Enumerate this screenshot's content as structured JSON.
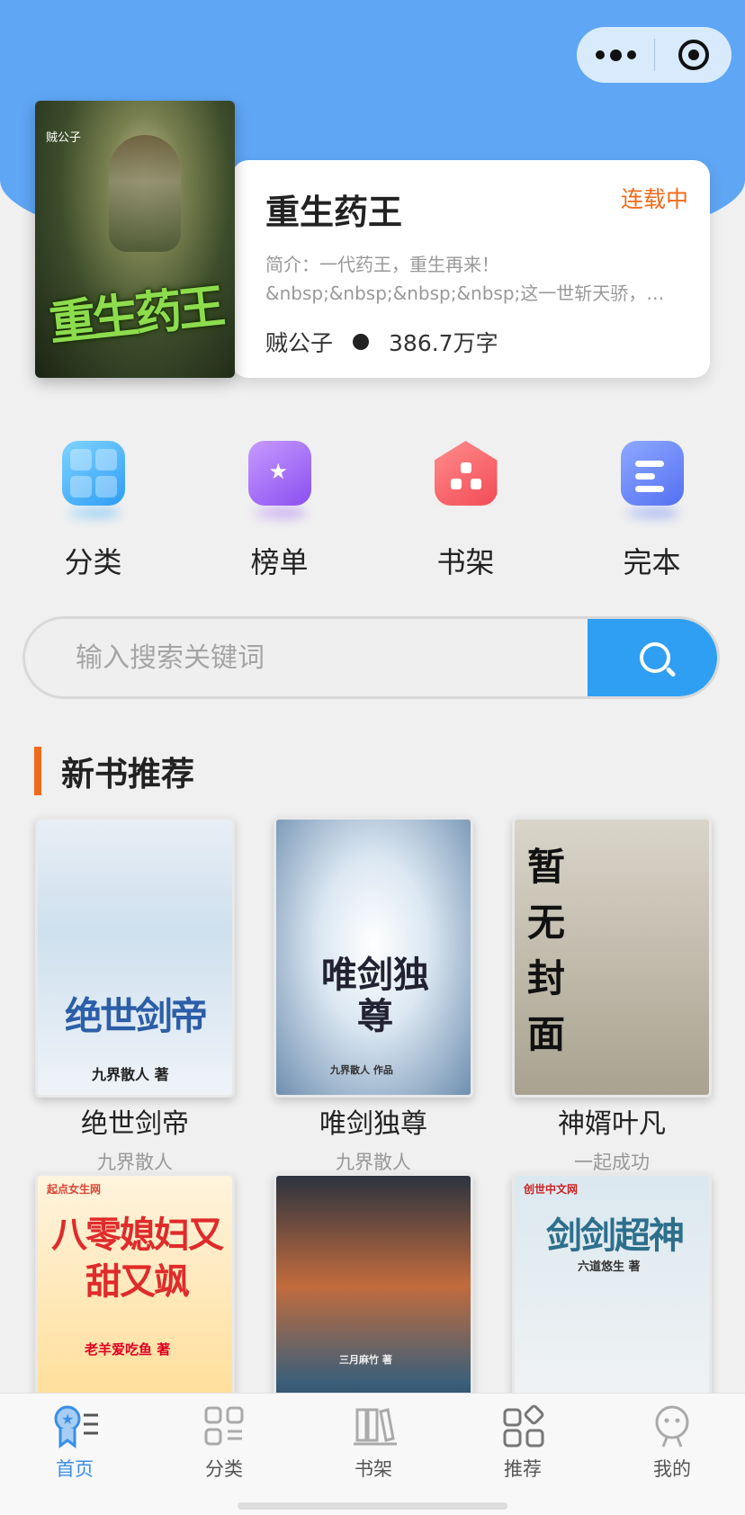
{
  "capsule": {
    "more_icon": "more-dots-icon",
    "close_icon": "target-icon"
  },
  "feature": {
    "cover_author": "贼公子",
    "cover_title": "重生药王",
    "title": "重生药王",
    "status": "连载中",
    "intro_line1": "简介：一代药王，重生再来！",
    "intro_line2": "&nbsp;&nbsp;&nbsp;&nbsp;这一世斩天骄，…",
    "author": "贼公子",
    "words": "386.7万字"
  },
  "nav": [
    {
      "label": "分类",
      "icon": "category-grid-icon",
      "color": "#2d9df5"
    },
    {
      "label": "榜单",
      "icon": "ranking-star-icon",
      "color": "#8a4ef0"
    },
    {
      "label": "书架",
      "icon": "bookshelf-house-icon",
      "color": "#f24b55"
    },
    {
      "label": "完本",
      "icon": "completed-book-icon",
      "color": "#5470f2"
    }
  ],
  "search": {
    "placeholder": "输入搜索关键词",
    "button_icon": "search-icon"
  },
  "section": {
    "title": "新书推荐",
    "accent": "#f06a1c"
  },
  "books": [
    {
      "title": "绝世剑帝",
      "author": "九界散人",
      "cover_text": "绝世剑帝",
      "cover_sub": "九界散人 著"
    },
    {
      "title": "唯剑独尊",
      "author": "九界散人",
      "cover_text": "唯剑独尊",
      "cover_sub": "九界散人 作品"
    },
    {
      "title": "神婿叶凡",
      "author": "一起成功",
      "cover_text": "暂无封面",
      "cover_sub": ""
    },
    {
      "title": "",
      "author": "",
      "cover_text": "八零媳妇又甜又飒",
      "cover_sub": "老羊爱吃鱼 著",
      "cover_tag": "起点女生网"
    },
    {
      "title": "",
      "author": "",
      "cover_text": "",
      "cover_sub": "三月麻竹 著"
    },
    {
      "title": "",
      "author": "",
      "cover_text": "剑剑超神",
      "cover_sub": "六道悠生 著",
      "cover_tag": "创世中文网"
    }
  ],
  "tabbar": [
    {
      "label": "首页",
      "icon": "home-ribbon-icon",
      "active": true
    },
    {
      "label": "分类",
      "icon": "category-icon",
      "active": false
    },
    {
      "label": "书架",
      "icon": "bookshelf-icon",
      "active": false
    },
    {
      "label": "推荐",
      "icon": "recommend-icon",
      "active": false
    },
    {
      "label": "我的",
      "icon": "profile-icon",
      "active": false
    }
  ],
  "colors": {
    "header_blue": "#5fa6f5",
    "search_button": "#2f9ff4",
    "tab_active": "#3a8ee6"
  }
}
